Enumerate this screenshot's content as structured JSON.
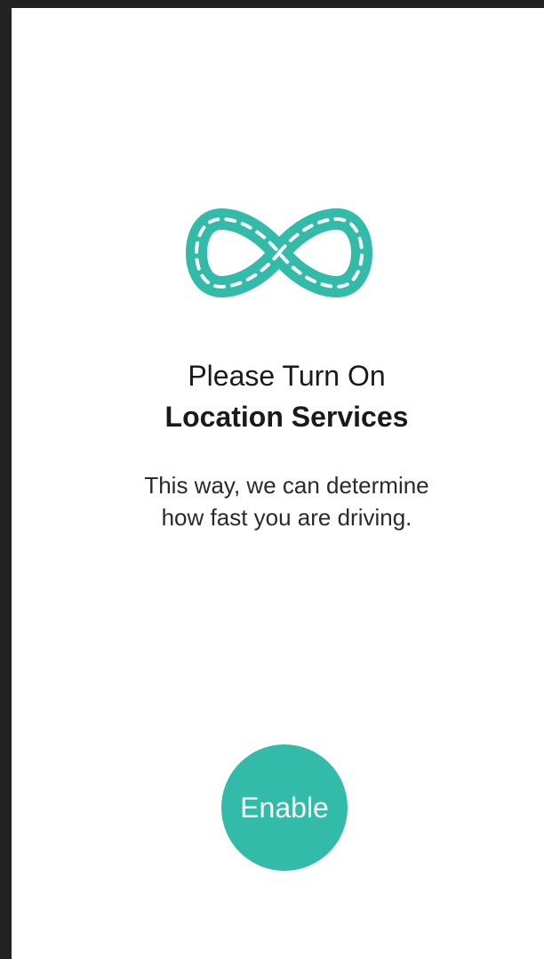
{
  "colors": {
    "accent": "#33bba9",
    "background": "#ffffff",
    "frame": "#222222",
    "text": "#1a1a1a"
  },
  "logo": {
    "icon": "infinity-road-icon"
  },
  "heading": {
    "line1": "Please Turn On",
    "line2": "Location Services"
  },
  "description": {
    "line1": "This way, we can determine",
    "line2": "how fast you are driving."
  },
  "actions": {
    "enable_label": "Enable"
  }
}
